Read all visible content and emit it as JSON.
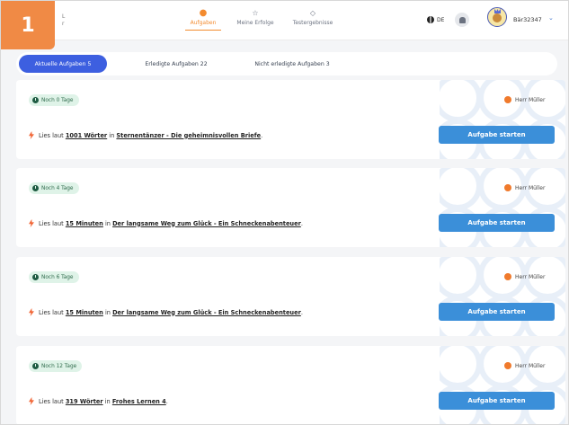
{
  "header": {
    "logo_line1": "L",
    "logo_line2": "r",
    "nav": [
      {
        "label": "Aufgaben",
        "icon": "dot-icon",
        "active": true
      },
      {
        "label": "Meine Erfolge",
        "icon": "star-icon",
        "active": false
      },
      {
        "label": "Testergebnisse",
        "icon": "diamond-icon",
        "active": false
      }
    ],
    "language": "DE",
    "username": "Bär32347"
  },
  "badge": "1",
  "tabs": [
    {
      "label": "Aktuelle Aufgaben 5",
      "active": true
    },
    {
      "label": "Erledigte Aufgaben 22",
      "active": false
    },
    {
      "label": "Nicht erledigte Aufgaben 3",
      "active": false
    }
  ],
  "cards": [
    {
      "due": "Noch 0 Tage",
      "teacher": "Herr Müller",
      "task_prefix": "Lies laut",
      "amount": "1001 Wörter",
      "in": "in",
      "book": "Sternentänzer - Die geheimnisvollen Briefe",
      "suffix": ".",
      "button": "Aufgabe starten"
    },
    {
      "due": "Noch 4 Tage",
      "teacher": "Herr Müller",
      "task_prefix": "Lies laut",
      "amount": "15 Minuten",
      "in": "in",
      "book": "Der langsame Weg zum Glück - Ein Schneckenabenteuer",
      "suffix": ".",
      "button": "Aufgabe starten"
    },
    {
      "due": "Noch 6 Tage",
      "teacher": "Herr Müller",
      "task_prefix": "Lies laut",
      "amount": "15 Minuten",
      "in": "in",
      "book": "Der langsame Weg zum Glück - Ein Schneckenabenteuer",
      "suffix": ".",
      "button": "Aufgabe starten"
    },
    {
      "due": "Noch 12 Tage",
      "teacher": "Herr Müller",
      "task_prefix": "Lies laut",
      "amount": "319 Wörter",
      "in": "in",
      "book": "Frohes Lernen 4",
      "suffix": ".",
      "button": "Aufgabe starten"
    }
  ],
  "colors": {
    "accent": "#f38b2f",
    "primary": "#3d5fe0",
    "button": "#3b8fd9",
    "due_bg": "#dff3e8"
  }
}
